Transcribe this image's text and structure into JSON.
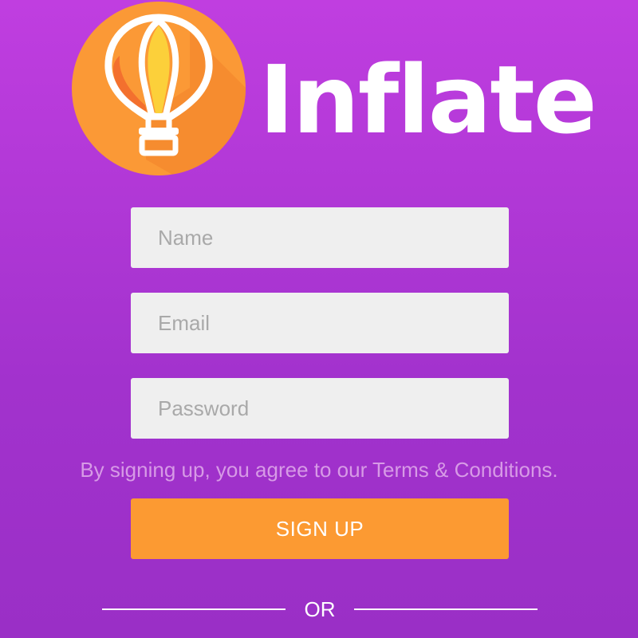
{
  "brand": {
    "name": "Inflate",
    "logo_icon": "hot-air-balloon-icon"
  },
  "form": {
    "name_placeholder": "Name",
    "email_placeholder": "Email",
    "password_placeholder": "Password",
    "terms_text": "By signing up, you agree to our Terms & Conditions.",
    "signup_label": "SIGN UP",
    "or_label": "OR"
  },
  "colors": {
    "background_top": "#c03ee0",
    "background_bottom": "#9a2fc6",
    "logo_circle": "#fb9936",
    "accent_button": "#fc9a32",
    "field_background": "#efefef",
    "terms_text": "#d79ae6"
  }
}
